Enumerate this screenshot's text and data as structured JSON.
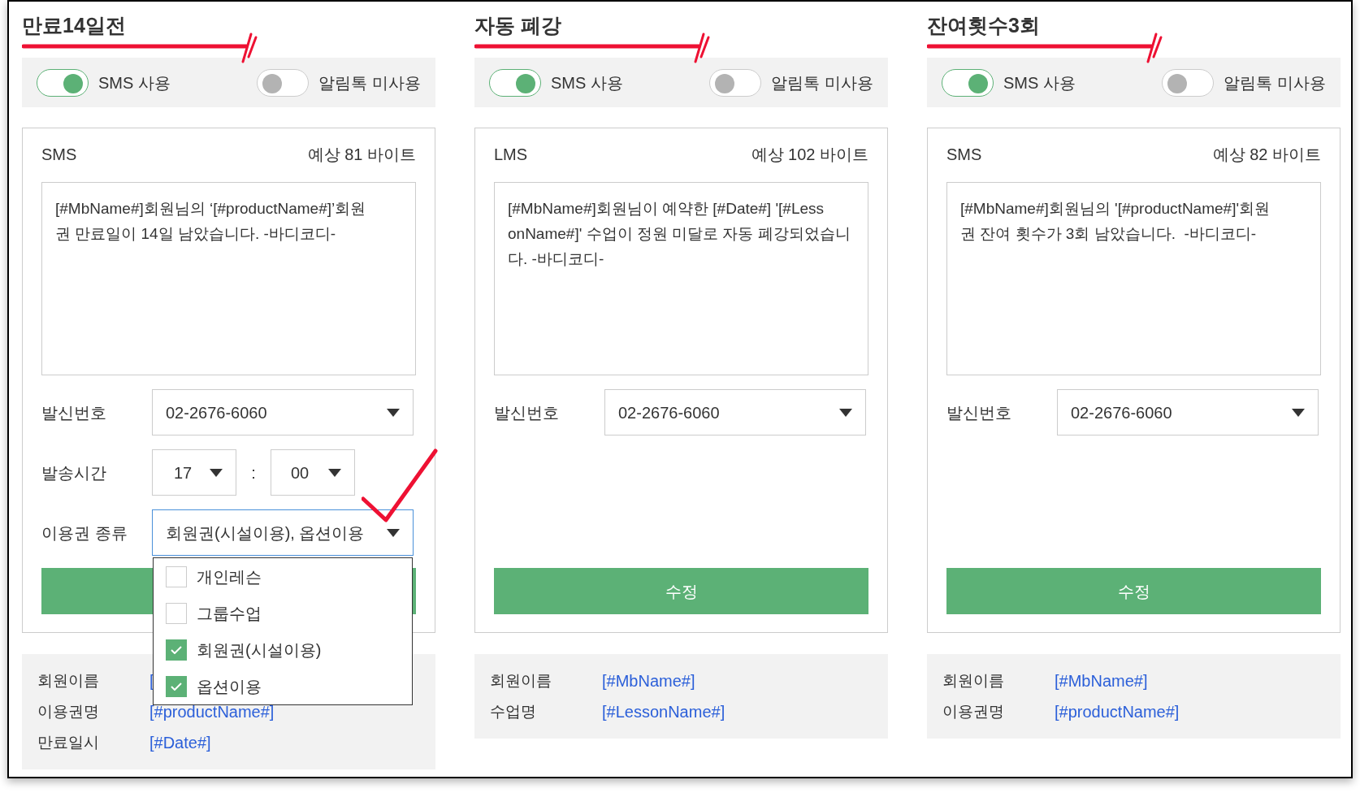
{
  "columns": [
    {
      "title": "만료14일전",
      "sms_toggle": {
        "label": "SMS 사용",
        "on": true
      },
      "alimtalk_toggle": {
        "label": "알림톡 미사용",
        "on": false
      },
      "message": {
        "type": "SMS",
        "bytes": "예상 81 바이트",
        "lines": [
          "[#MbName#]회원님의 ‘[#productName#]’회원",
          "권 만료일이 14일 남았습니다. -바디코디-"
        ]
      },
      "fields": [
        {
          "kind": "select",
          "label": "발신번호",
          "value": "02-2676-6060"
        },
        {
          "kind": "time",
          "label": "발송시간",
          "hour": "17",
          "separator": ":",
          "minute": "00"
        },
        {
          "kind": "multiselect",
          "label": "이용권 종류",
          "value": "회원권(시설이용), 옵션이용",
          "expanded": true,
          "options": [
            {
              "label": "개인레슨",
              "checked": false
            },
            {
              "label": "그룹수업",
              "checked": false
            },
            {
              "label": "회원권(시설이용)",
              "checked": true
            },
            {
              "label": "옵션이용",
              "checked": true
            }
          ]
        }
      ],
      "annotation_check": true,
      "variables": [
        {
          "label": "회원이름",
          "value": "["
        },
        {
          "label": "이용권명",
          "value": "[#productName#]"
        },
        {
          "label": "만료일시",
          "value": "[#Date#]"
        }
      ]
    },
    {
      "title": "자동 폐강",
      "sms_toggle": {
        "label": "SMS 사용",
        "on": true
      },
      "alimtalk_toggle": {
        "label": "알림톡 미사용",
        "on": false
      },
      "message": {
        "type": "LMS",
        "bytes": "예상 102 바이트",
        "lines": [
          "[#MbName#]회원님이 예약한 [#Date#] '[#Less",
          "onName#]' 수업이 정원 미달로 자동 폐강되었습니",
          "다. -바디코디-"
        ]
      },
      "fields": [
        {
          "kind": "select",
          "label": "발신번호",
          "value": "02-2676-6060"
        }
      ],
      "button": {
        "label": "수정"
      },
      "annotation_check": false,
      "variables": [
        {
          "label": "회원이름",
          "value": "[#MbName#]"
        },
        {
          "label": "수업명",
          "value": "[#LessonName#]"
        }
      ]
    },
    {
      "title": "잔여횟수3회",
      "sms_toggle": {
        "label": "SMS 사용",
        "on": true
      },
      "alimtalk_toggle": {
        "label": "알림톡 미사용",
        "on": false
      },
      "message": {
        "type": "SMS",
        "bytes": "예상 82 바이트",
        "lines": [
          "[#MbName#]회원님의 '[#productName#]'회원",
          "권 잔여 횟수가 3회 남았습니다.  -바디코디-"
        ]
      },
      "fields": [
        {
          "kind": "select",
          "label": "발신번호",
          "value": "02-2676-6060"
        }
      ],
      "button": {
        "label": "수정"
      },
      "annotation_check": false,
      "variables": [
        {
          "label": "회원이름",
          "value": "[#MbName#]"
        },
        {
          "label": "이용권명",
          "value": "[#productName#]"
        }
      ]
    }
  ]
}
